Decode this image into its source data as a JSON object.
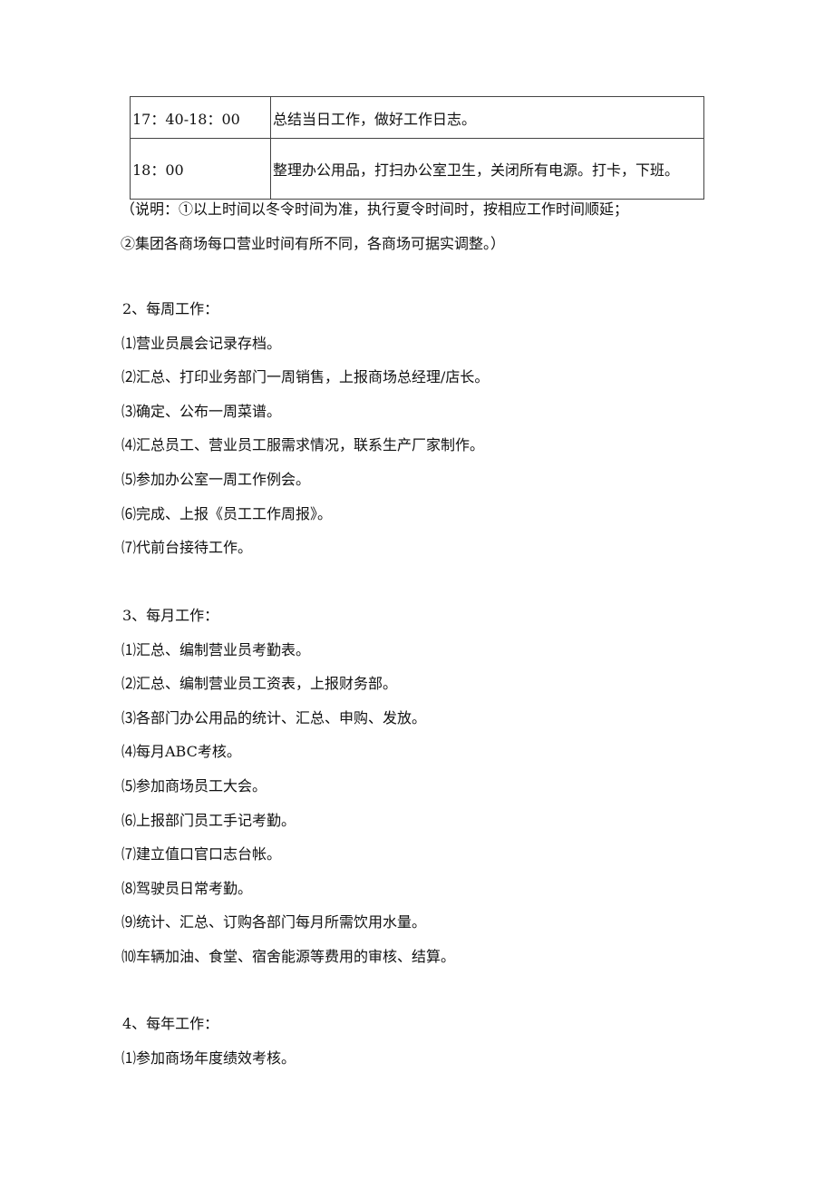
{
  "table": {
    "rows": [
      {
        "time": "17：40-18：00",
        "task": "总结当日工作，做好工作日志。"
      },
      {
        "time": "18：00",
        "task": "整理办公用品，打扫办公室卫生，关闭所有电源。打卡，下班。"
      }
    ]
  },
  "notes": [
    "（说明：①以上时间以冬令时间为准，执行夏令时间时，按相应工作时间顺延；",
    "②集团各商场每口营业时间有所不同，各商场可据实调整。）"
  ],
  "weekly": {
    "heading": "2、每周工作：",
    "items": [
      "⑴营业员晨会记录存档。",
      "⑵汇总、打印业务部门一周销售，上报商场总经理/店长。",
      "⑶确定、公布一周菜谱。",
      "⑷汇总员工、营业员工服需求情况，联系生产厂家制作。",
      "⑸参加办公室一周工作例会。",
      "⑹完成、上报《员工工作周报》。",
      "⑺代前台接待工作。"
    ]
  },
  "monthly": {
    "heading": "3、每月工作：",
    "items": [
      "⑴汇总、编制营业员考勤表。",
      "⑵汇总、编制营业员工资表，上报财务部。",
      "⑶各部门办公用品的统计、汇总、申购、发放。",
      "⑷每月ABC考核。",
      "⑸参加商场员工大会。",
      "⑹上报部门员工手记考勤。",
      "⑺建立值口官口志台帐。",
      "⑻驾驶员日常考勤。",
      "⑼统计、汇总、订购各部门每月所需饮用水量。",
      "⑽车辆加油、食堂、宿舍能源等费用的审核、结算。"
    ]
  },
  "yearly": {
    "heading": "4、每年工作：",
    "items": [
      "⑴参加商场年度绩效考核。"
    ]
  }
}
